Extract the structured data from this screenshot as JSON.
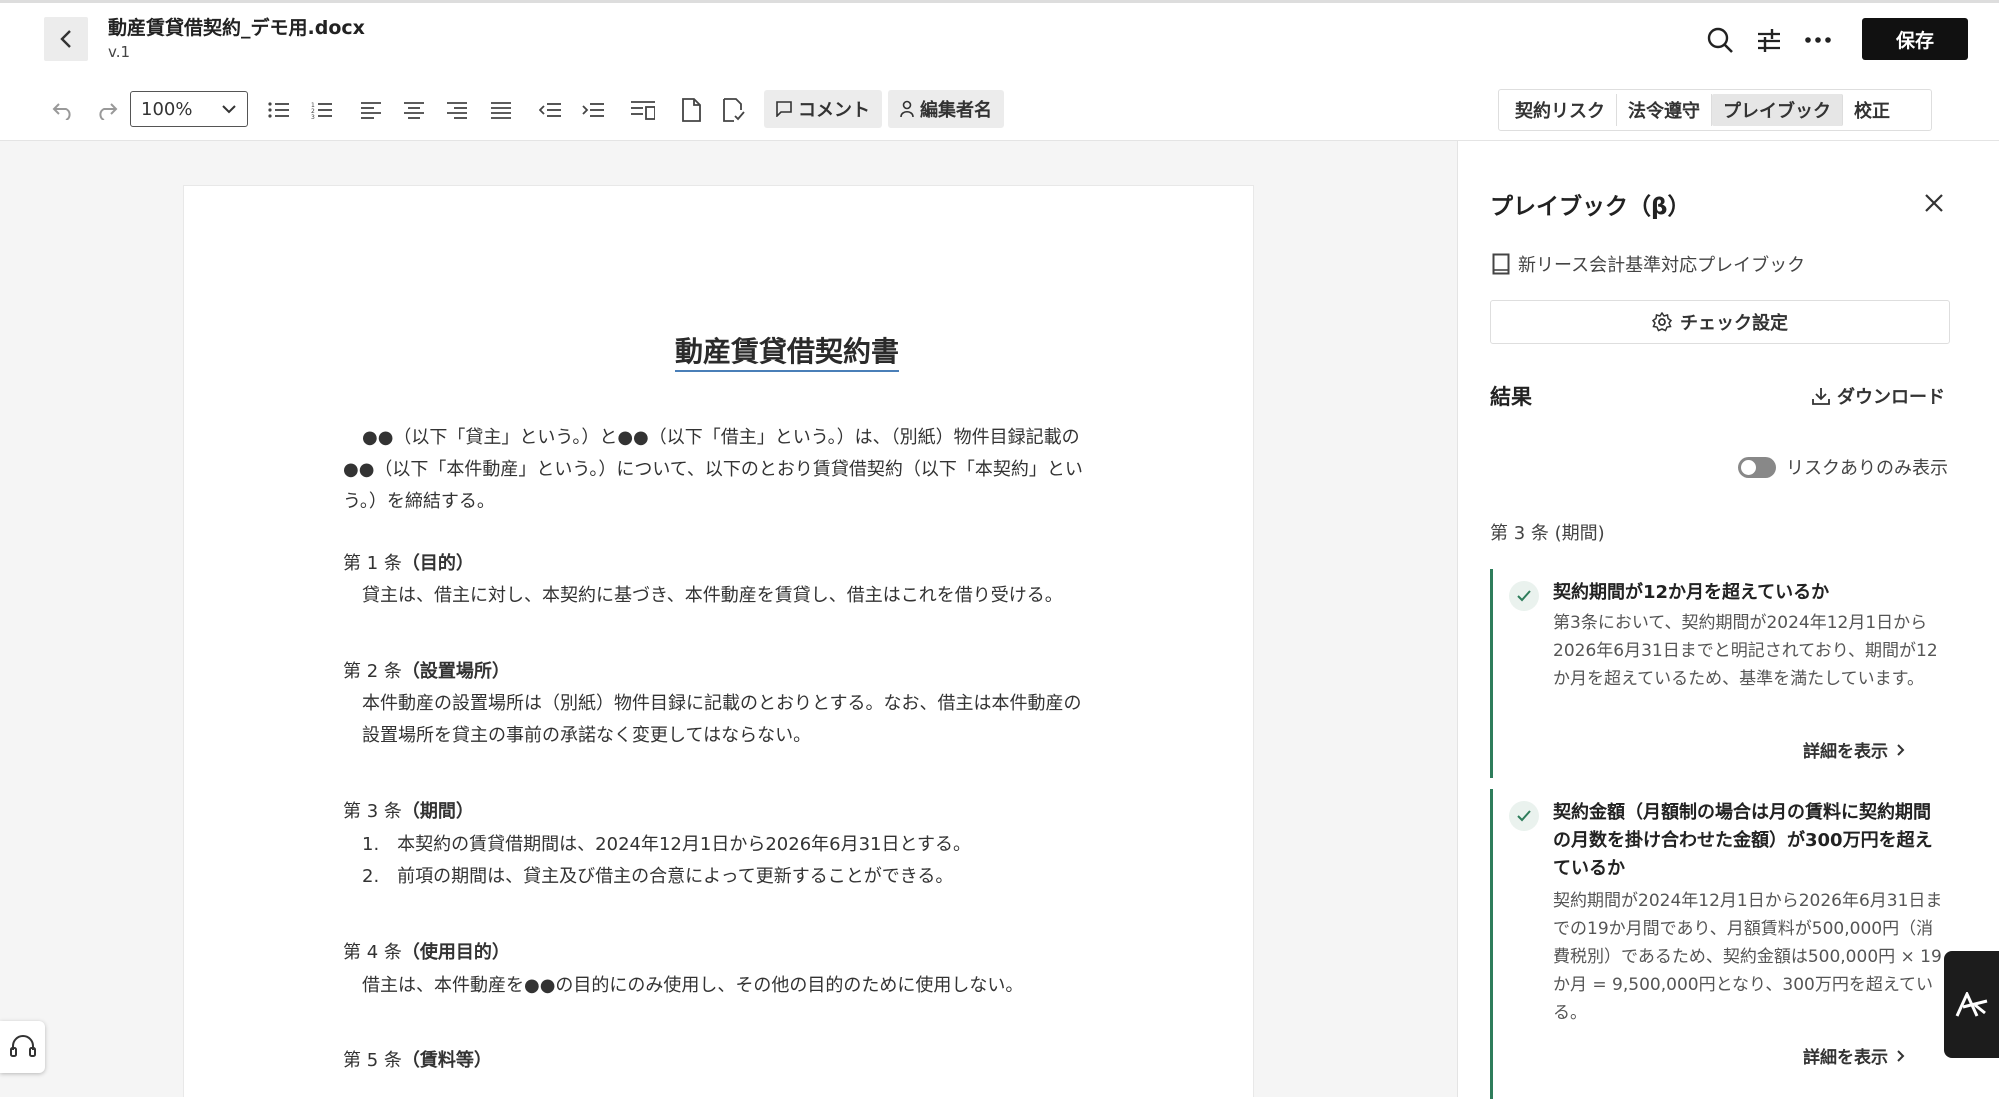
{
  "header": {
    "filename": "動産賃貸借契約_デモ用.docx",
    "version": "v.1",
    "save_label": "保存"
  },
  "toolbar": {
    "zoom": "100%",
    "comment_label": "コメント",
    "editor_label": "編集者名"
  },
  "tabs": [
    {
      "label": "契約リスク",
      "active": false
    },
    {
      "label": "法令遵守",
      "active": false
    },
    {
      "label": "プレイブック",
      "active": true
    },
    {
      "label": "校正",
      "active": false
    }
  ],
  "document": {
    "title": "動産賃貸借契約書",
    "intro": "●●（以下「貸主」という。）と●●（以下「借主」という。）は、（別紙）物件目録記載の●●（以下「本件動産」という。）について、以下のとおり賃貸借契約（以下「本契約」という。）を締結する。",
    "articles": [
      {
        "num": "第 1 条",
        "title": "（目的）",
        "lines": [
          "貸主は、借主に対し、本契約に基づき、本件動産を賃貸し、借主はこれを借り受ける。"
        ]
      },
      {
        "num": "第 2 条",
        "title": "（設置場所）",
        "lines": [
          "本件動産の設置場所は（別紙）物件目録に記載のとおりとする。なお、借主は本件動産の",
          "設置場所を貸主の事前の承諾なく変更してはならない。"
        ]
      },
      {
        "num": "第 3 条",
        "title": "（期間）",
        "lines": [
          "1.　本契約の賃貸借期間は、2024年12月1日から2026年6月31日とする。",
          "2.　前項の期間は、貸主及び借主の合意によって更新することができる。"
        ]
      },
      {
        "num": "第 4 条",
        "title": "（使用目的）",
        "lines": [
          "借主は、本件動産を●●の目的にのみ使用し、その他の目的のために使用しない。"
        ]
      },
      {
        "num": "第 5 条",
        "title": "（賃料等）",
        "lines": []
      }
    ]
  },
  "panel": {
    "title": "プレイブック（β）",
    "playbook_name": "新リース会計基準対応プレイブック",
    "check_settings_label": "チェック設定",
    "results_label": "結果",
    "download_label": "ダウンロード",
    "risk_only_label": "リスクありのみ表示",
    "risk_only_on": false,
    "section": "第 3 条 (期間)",
    "results": [
      {
        "title": "契約期間が12か月を超えているか",
        "body": "第3条において、契約期間が2024年12月1日から2026年6月31日までと明記されており、期間が12か月を超えているため、基準を満たしています。",
        "details_label": "詳細を表示"
      },
      {
        "title": "契約金額（月額制の場合は月の賃料に契約期間の月数を掛け合わせた金額）が300万円を超えているか",
        "body": "契約期間が2024年12月1日から2026年6月31日までの19か月間であり、月額賃料が500,000円（消費税別）であるため、契約金額は500,000円 × 19か月 = 9,500,000円となり、300万円を超えている。",
        "details_label": "詳細を表示"
      }
    ]
  },
  "colors": {
    "accent_green": "#2e7d5b",
    "primary_button": "#111111",
    "title_underline": "#4a7fb8"
  },
  "icons": [
    "back-icon",
    "search-icon",
    "filter-icon",
    "more-icon",
    "undo-icon",
    "redo-icon",
    "chevron-down-icon",
    "bullet-list-icon",
    "numbered-list-icon",
    "align-left-icon",
    "align-center-icon",
    "align-right-icon",
    "align-justify-icon",
    "outdent-icon",
    "indent-icon",
    "wrap-icon",
    "document-icon",
    "document-check-icon",
    "comment-icon",
    "person-icon",
    "close-icon",
    "book-icon",
    "gear-icon",
    "download-icon",
    "check-icon",
    "chevron-right-icon",
    "headset-icon",
    "ai-icon"
  ]
}
